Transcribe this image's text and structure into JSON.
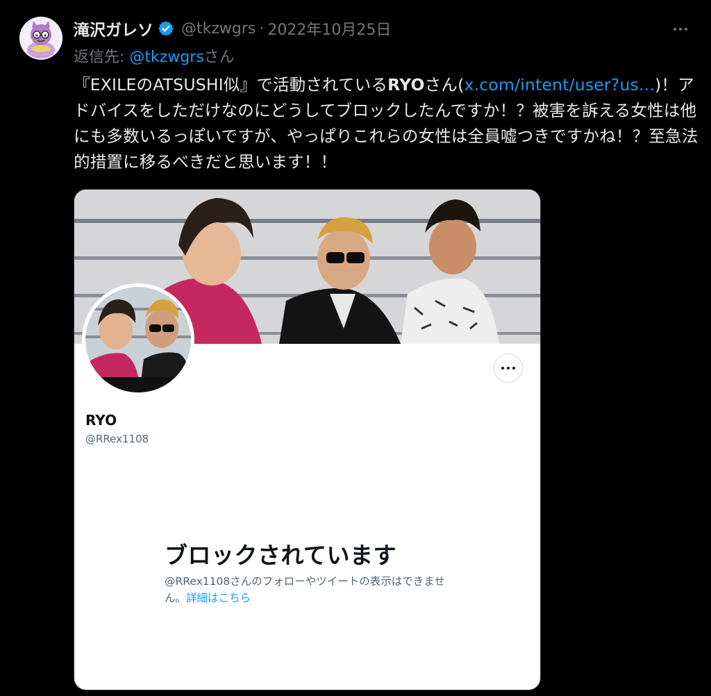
{
  "tweet": {
    "author_name": "滝沢ガレソ",
    "handle": "@tkzwgrs",
    "separator": "·",
    "date": "2022年10月25日",
    "reply_prefix": "返信先: ",
    "reply_mention": "@tkzwgrs",
    "reply_suffix": "さん",
    "text_part1": "『EXILEのATSUSHI似』で活動されている",
    "text_bold": "RYO",
    "text_part2": "さん(",
    "text_link": "x.com/intent/user?us...",
    "text_part3": ")！アドバイスをしただけなのにどうしてブロックしたんですか！？被害を訴える女性は他にも多数いるっぽいですが、やっぱりこれらの女性は全員嘘つきですかね！？至急法的措置に移るべきだと思います！！"
  },
  "card": {
    "profile_name": "RYO",
    "profile_handle": "@RRex1108",
    "blocked_title": "ブロックされています",
    "blocked_desc": "@RRex1108さんのフォローやツイートの表示はできません。",
    "learn_more": "詳細はこちら"
  },
  "colors": {
    "background": "#000000",
    "text": "#e7e9ea",
    "secondary": "#71767b",
    "accent": "#1d9bf0",
    "verified": "#1d9bf0"
  },
  "icons": [
    "verified-badge-icon",
    "more-options-icon",
    "card-more-options-icon"
  ]
}
